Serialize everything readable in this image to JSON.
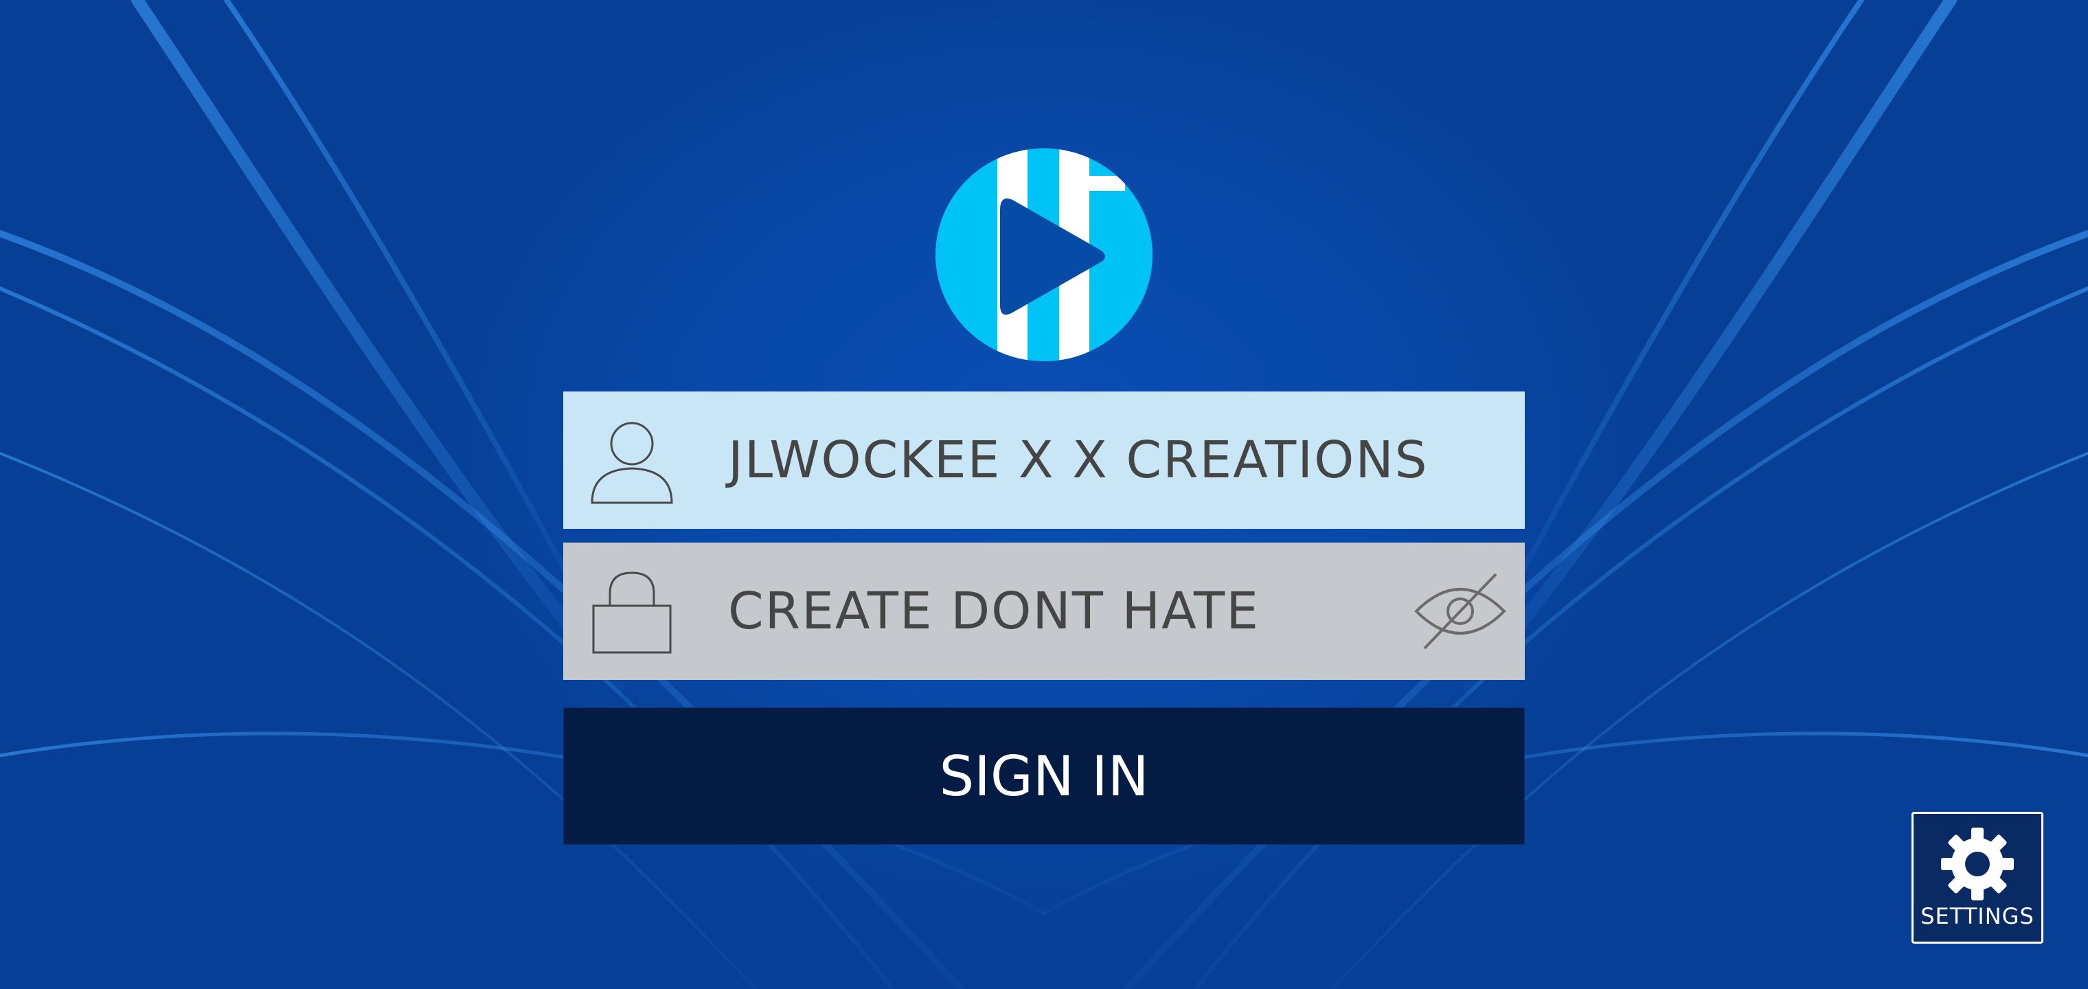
{
  "login": {
    "username_value": "JLWOCKEE X X CREATIONS",
    "password_value": "CREATE DONT HATE",
    "sign_in_label": "SIGN IN"
  },
  "settings": {
    "label": "SETTINGS"
  },
  "icons": {
    "logo": "play-logo-icon",
    "user": "user-icon",
    "lock": "lock-icon",
    "visibility": "eye-slash-icon",
    "settings": "gear-icon"
  },
  "colors": {
    "background": "#0a4fb2",
    "username_field": "#c9e6f7",
    "password_field": "#c5c8cc",
    "sign_in_button": "#041c44",
    "logo_cyan": "#00c3f5",
    "logo_dark": "#064ca7"
  }
}
